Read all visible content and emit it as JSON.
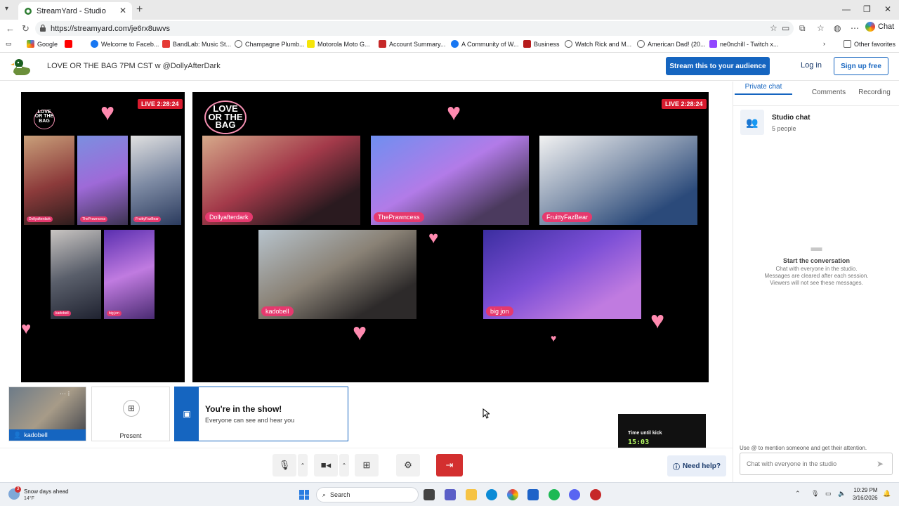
{
  "browser": {
    "tab_title": "StreamYard - Studio",
    "url": "https://streamyard.com/je6rx8uwvs",
    "chat_label": "Chat",
    "bookmarks": [
      {
        "label": "Google",
        "color": "#ffffff"
      },
      {
        "label": "",
        "color": "#ff0000"
      },
      {
        "label": "Welcome to Faceb...",
        "color": "#1877f2"
      },
      {
        "label": "BandLab: Music St...",
        "color": "#e53935"
      },
      {
        "label": "Champagne Plumb...",
        "color": "#888888"
      },
      {
        "label": "Motorola Moto G...",
        "color": "#f5e50a"
      },
      {
        "label": "Account Summary...",
        "color": "#c62828"
      },
      {
        "label": "A Community of W...",
        "color": "#1877f2"
      },
      {
        "label": "Business",
        "color": "#b71c1c"
      },
      {
        "label": "Watch Rick and M...",
        "color": "#888888"
      },
      {
        "label": "American Dad! (20...",
        "color": "#888888"
      },
      {
        "label": "ne0nchill - Twitch x...",
        "color": "#9146ff"
      }
    ],
    "other_favorites": "Other favorites"
  },
  "header": {
    "broadcast_title": "LOVE OR THE BAG 7PM CST w @DollyAfterDark",
    "stream_button": "Stream this to your audience",
    "login": "Log in",
    "signup": "Sign up free"
  },
  "stage": {
    "live_label": "LIVE 2:28:24",
    "logo_text": "LOVE OR THE BAG",
    "main_participants": [
      "Dollyafterdark",
      "ThePrawncess",
      "FruittyFazBear",
      "kadobell",
      "big jon"
    ],
    "preview_participants": [
      "Dollyafterdark",
      "ThePrawncess",
      "FruittyFazBear",
      "kadobell",
      "big jon"
    ],
    "kick_label": "Time until kick",
    "kick_time": "15:03"
  },
  "strip": {
    "self_name": "kadobell",
    "present_label": "Present",
    "banner_title": "You're in the show!",
    "banner_sub": "Everyone can see and hear you"
  },
  "controls": {
    "help": "Need help?"
  },
  "panel": {
    "tabs": [
      "Private chat",
      "Comments",
      "Recording"
    ],
    "studio_chat_title": "Studio chat",
    "studio_chat_count": "5 people",
    "empty_heading": "Start the conversation",
    "empty_body": "Chat with everyone in the studio.\nMessages are cleared after each session.\nViewers will not see these messages.",
    "mention_hint": "Use @ to mention someone and get their attention.",
    "chat_placeholder": "Chat with everyone in the studio"
  },
  "taskbar": {
    "weather_title": "Snow days ahead",
    "weather_temp": "14°F",
    "weather_badge": "3",
    "search": "Search",
    "time": "10:29 PM",
    "date": "3/16/2026"
  },
  "colors": {
    "accent": "#1565c0",
    "live": "#d81b2e",
    "nametag": "#e6396e",
    "leave": "#d32f2f"
  }
}
